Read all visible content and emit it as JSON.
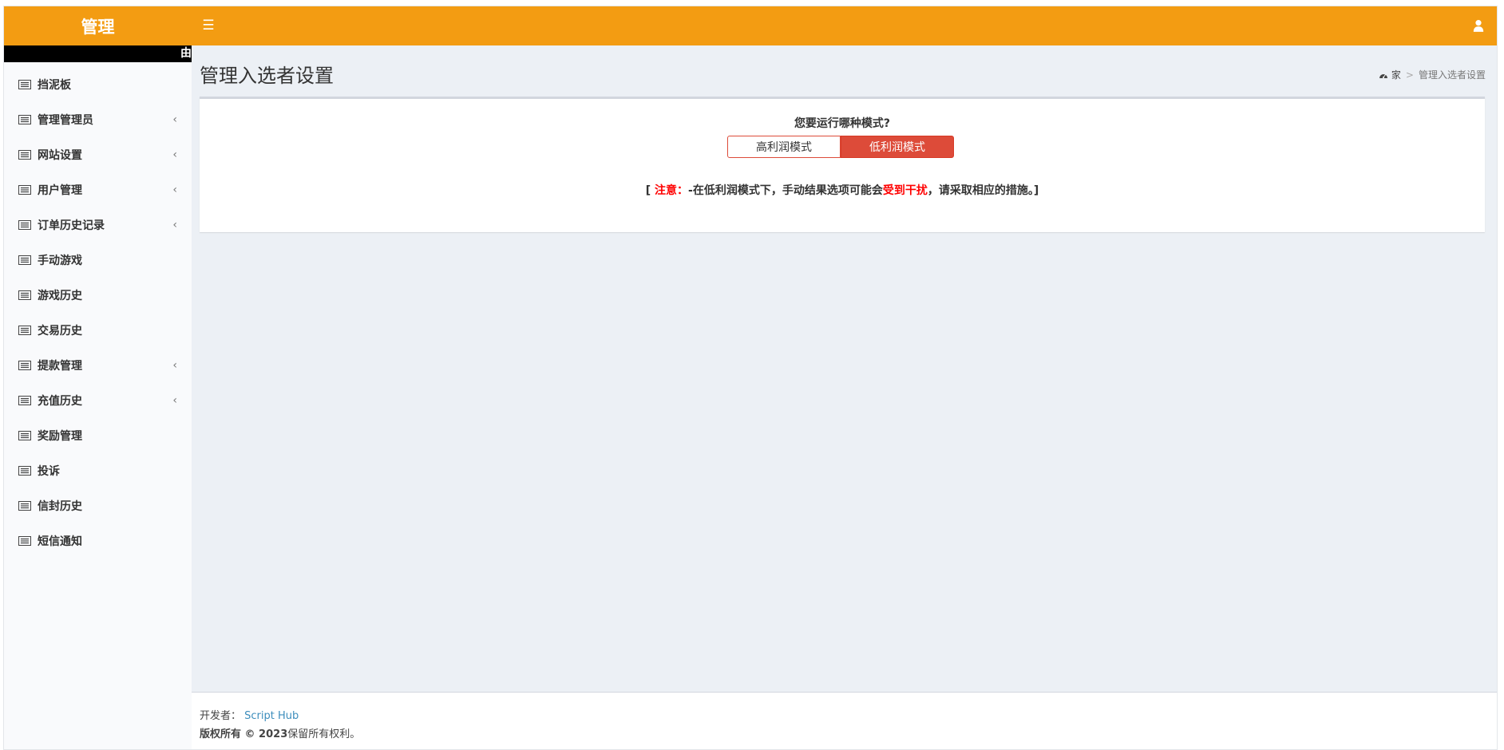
{
  "header": {
    "logo": "管理",
    "menu_toggle_icon": "hamburger-icon",
    "user_icon": "user-icon",
    "accent_color": "#f39c12"
  },
  "sidebar": {
    "strip_text": "由",
    "items": [
      {
        "label": "挡泥板",
        "icon": "list-icon",
        "has_submenu": false
      },
      {
        "label": "管理管理员",
        "icon": "list-icon",
        "has_submenu": true
      },
      {
        "label": "网站设置",
        "icon": "list-icon",
        "has_submenu": true
      },
      {
        "label": "用户管理",
        "icon": "list-icon",
        "has_submenu": true
      },
      {
        "label": "订单历史记录",
        "icon": "list-icon",
        "has_submenu": true
      },
      {
        "label": "手动游戏",
        "icon": "list-icon",
        "has_submenu": false
      },
      {
        "label": "游戏历史",
        "icon": "list-icon",
        "has_submenu": false
      },
      {
        "label": "交易历史",
        "icon": "list-icon",
        "has_submenu": false
      },
      {
        "label": "提款管理",
        "icon": "list-icon",
        "has_submenu": true
      },
      {
        "label": "充值历史",
        "icon": "list-icon",
        "has_submenu": true
      },
      {
        "label": "奖励管理",
        "icon": "list-icon",
        "has_submenu": false
      },
      {
        "label": "投诉",
        "icon": "list-icon",
        "has_submenu": false
      },
      {
        "label": "信封历史",
        "icon": "list-icon",
        "has_submenu": false
      },
      {
        "label": "短信通知",
        "icon": "list-icon",
        "has_submenu": false
      }
    ],
    "chevron": "‹"
  },
  "main": {
    "title": "管理入选者设置",
    "breadcrumb": {
      "home": "家",
      "separator": ">",
      "current": "管理入选者设置"
    },
    "question": "您要运行哪种模式?",
    "modes": {
      "high": "高利润模式",
      "low": "低利润模式",
      "selected": "低利润模式"
    },
    "notice": {
      "open": "[ ",
      "label": "注意：",
      "text1": "-在低利润模式下，手动结果选项可能会",
      "highlight": "受到干扰",
      "text2": "，请采取相应的措施。]"
    }
  },
  "footer": {
    "developer_label": "开发者：",
    "developer_link": "Script Hub",
    "copyright_bold": "版权所有 © 2023",
    "copyright_rest": "保留所有权利。"
  }
}
